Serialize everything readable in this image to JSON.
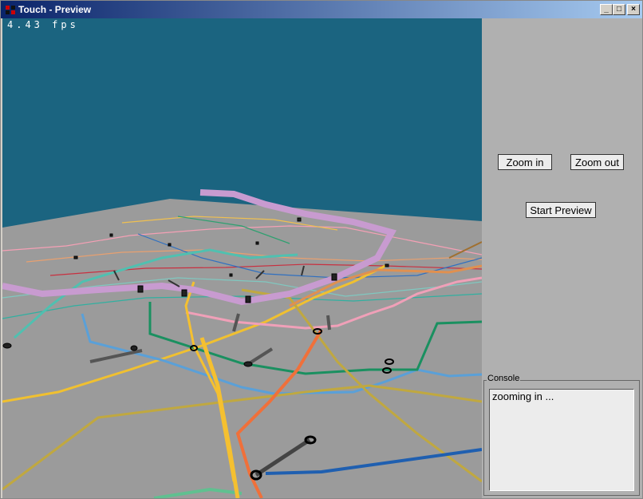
{
  "window": {
    "title": "Touch - Preview",
    "minimize": "_",
    "maximize": "□",
    "close": "×"
  },
  "viewport": {
    "fps_text": "4.43 fps",
    "sky_color": "#1b6480",
    "ground_color": "#9b9b9b"
  },
  "controls": {
    "zoom_in_label": "Zoom in",
    "zoom_out_label": "Zoom out",
    "start_preview_label": "Start Preview"
  },
  "console": {
    "label": "Console",
    "text": "zooming in ..."
  },
  "icons": [
    "app-icon",
    "minimize-icon",
    "maximize-icon",
    "close-icon"
  ]
}
